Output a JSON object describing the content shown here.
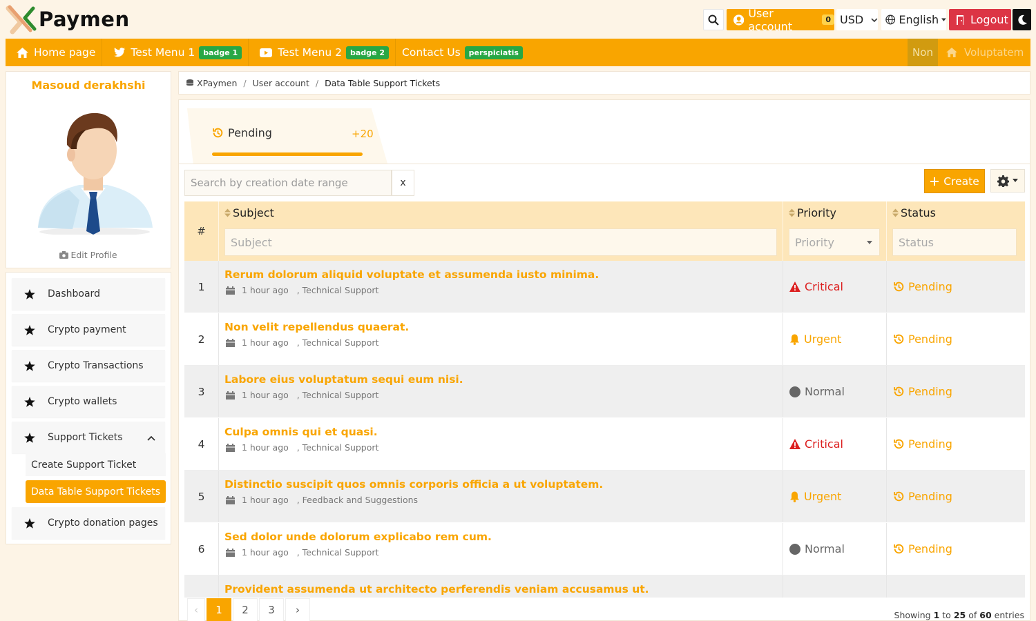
{
  "brand": {
    "logo_text": "Paymen"
  },
  "header": {
    "account_label": "User account",
    "account_count": "0",
    "currency": "USD",
    "language": "English",
    "logout_label": "Logout"
  },
  "nav": {
    "home": "Home page",
    "menu1": "Test Menu 1",
    "menu1_badge": "badge 1",
    "menu2": "Test Menu 2",
    "menu2_badge": "badge 2",
    "contact": "Contact Us",
    "contact_badge": "perspiciatis",
    "non": "Non",
    "voluptatem": "Voluptatem"
  },
  "profile": {
    "name": "Masoud derakhshi",
    "edit": "Edit Profile"
  },
  "sidebar": {
    "items": [
      {
        "label": "Dashboard"
      },
      {
        "label": "Crypto payment"
      },
      {
        "label": "Crypto Transactions"
      },
      {
        "label": "Crypto wallets"
      },
      {
        "label": "Support Tickets"
      },
      {
        "label": "Crypto donation pages"
      }
    ],
    "sub_items": [
      {
        "label": "Create Support Ticket"
      },
      {
        "label": "Data Table Support Tickets"
      }
    ]
  },
  "breadcrumb": {
    "root": "XPaymen",
    "level1": "User account",
    "current": "Data Table Support Tickets"
  },
  "tab": {
    "label": "Pending",
    "count": "+20"
  },
  "toolbar": {
    "date_placeholder": "Search by creation date range",
    "clear": "x",
    "create": "Create"
  },
  "table": {
    "headers": {
      "num": "#",
      "subject": "Subject",
      "priority": "Priority",
      "status": "Status"
    },
    "filters": {
      "subject": "Subject",
      "priority": "Priority",
      "status": "Status"
    },
    "rows": [
      {
        "num": "1",
        "subject": "Rerum dolorum aliquid voluptate et assumenda iusto minima.",
        "time": "1 hour ago",
        "category": ", Technical Support",
        "priority": "Critical",
        "status": "Pending"
      },
      {
        "num": "2",
        "subject": "Non velit repellendus quaerat.",
        "time": "1 hour ago",
        "category": ", Technical Support",
        "priority": "Urgent",
        "status": "Pending"
      },
      {
        "num": "3",
        "subject": "Labore eius voluptatum sequi eum nisi.",
        "time": "1 hour ago",
        "category": ", Technical Support",
        "priority": "Normal",
        "status": "Pending"
      },
      {
        "num": "4",
        "subject": "Culpa omnis qui et quasi.",
        "time": "1 hour ago",
        "category": ", Technical Support",
        "priority": "Critical",
        "status": "Pending"
      },
      {
        "num": "5",
        "subject": "Distinctio suscipit quos omnis corporis officia a ut voluptatem.",
        "time": "1 hour ago",
        "category": ", Feedback and Suggestions",
        "priority": "Urgent",
        "status": "Pending"
      },
      {
        "num": "6",
        "subject": "Sed dolor unde dolorum explicabo rem cum.",
        "time": "1 hour ago",
        "category": ", Technical Support",
        "priority": "Normal",
        "status": "Pending"
      },
      {
        "num": "",
        "subject": "Provident assumenda ut architecto perferendis veniam accusamus ut.",
        "time": "",
        "category": "",
        "priority": "",
        "status": ""
      }
    ]
  },
  "pagination": {
    "prev": "‹",
    "pages": [
      "1",
      "2",
      "3"
    ],
    "next": "›",
    "showing_prefix": "Showing",
    "from": "1",
    "to_word": "to",
    "to": "25",
    "of_word": "of",
    "total": "60",
    "suffix": "entries"
  },
  "colors": {
    "accent": "#f9a500",
    "critical": "#dc1f1f",
    "logout": "#dc3545",
    "badge": "#28a745"
  }
}
